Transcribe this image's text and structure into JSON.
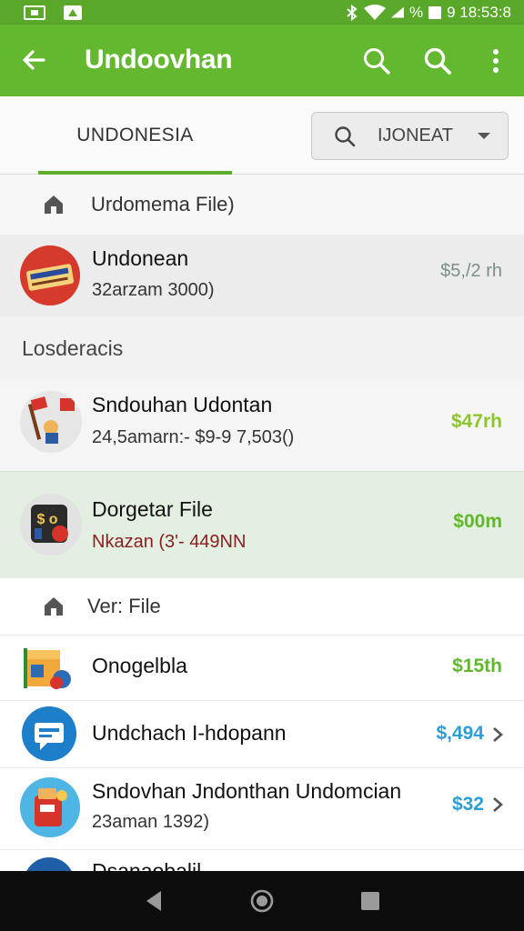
{
  "status_bar": {
    "time": "9 18:53:8",
    "battery_percent": "%",
    "icons": [
      "photo-icon",
      "drive-icon",
      "bluetooth-icon",
      "wifi-icon",
      "signal-icon",
      "battery-icon"
    ]
  },
  "app_bar": {
    "title": "Undoovhan",
    "icons": [
      "back-arrow-icon",
      "search-icon",
      "search-icon",
      "more-vert-icon"
    ]
  },
  "tabs": {
    "active_label": "UNDONESIA",
    "search_text": "IJONEAT"
  },
  "colors": {
    "primary": "#64b82f",
    "status": "#5aa82a",
    "price_green": "#7cc026",
    "price_blue": "#2a9fd6",
    "highlight": "#e3efe0"
  },
  "sections": {
    "top_header": "Urdomema File)",
    "middle_header": "Losderacis",
    "bottom_header": "Ver: File"
  },
  "items": [
    {
      "title": "Undonean",
      "subtitle": "32arzam 3000)",
      "price": "$5,/2 rh",
      "avatar": "red-badge-icon"
    },
    {
      "title": "Sndouhan Udontan",
      "subtitle": "24,5amarn:- $9-9 7,503()",
      "price": "$47rh",
      "avatar": "flags-icon"
    },
    {
      "title": "Dorgetar File",
      "subtitle": "Nkazan  (3'- 449NN",
      "price": "$00m",
      "avatar": "dollar-box-icon"
    },
    {
      "title": "Onogelbla",
      "subtitle": "",
      "price": "$15th",
      "avatar": "package-box-icon"
    },
    {
      "title": "Undchach I-hdopann",
      "subtitle": "",
      "price": "$,494",
      "avatar": "chat-bubble-icon"
    },
    {
      "title": "Sndovhan Jndonthan Undomcian",
      "subtitle": "23aman 1392)",
      "price": "$32",
      "avatar": "shopping-bag-icon"
    },
    {
      "title": "Dsanaobalil",
      "subtitle": "",
      "price": "",
      "avatar": "partial-avatar-icon"
    }
  ]
}
